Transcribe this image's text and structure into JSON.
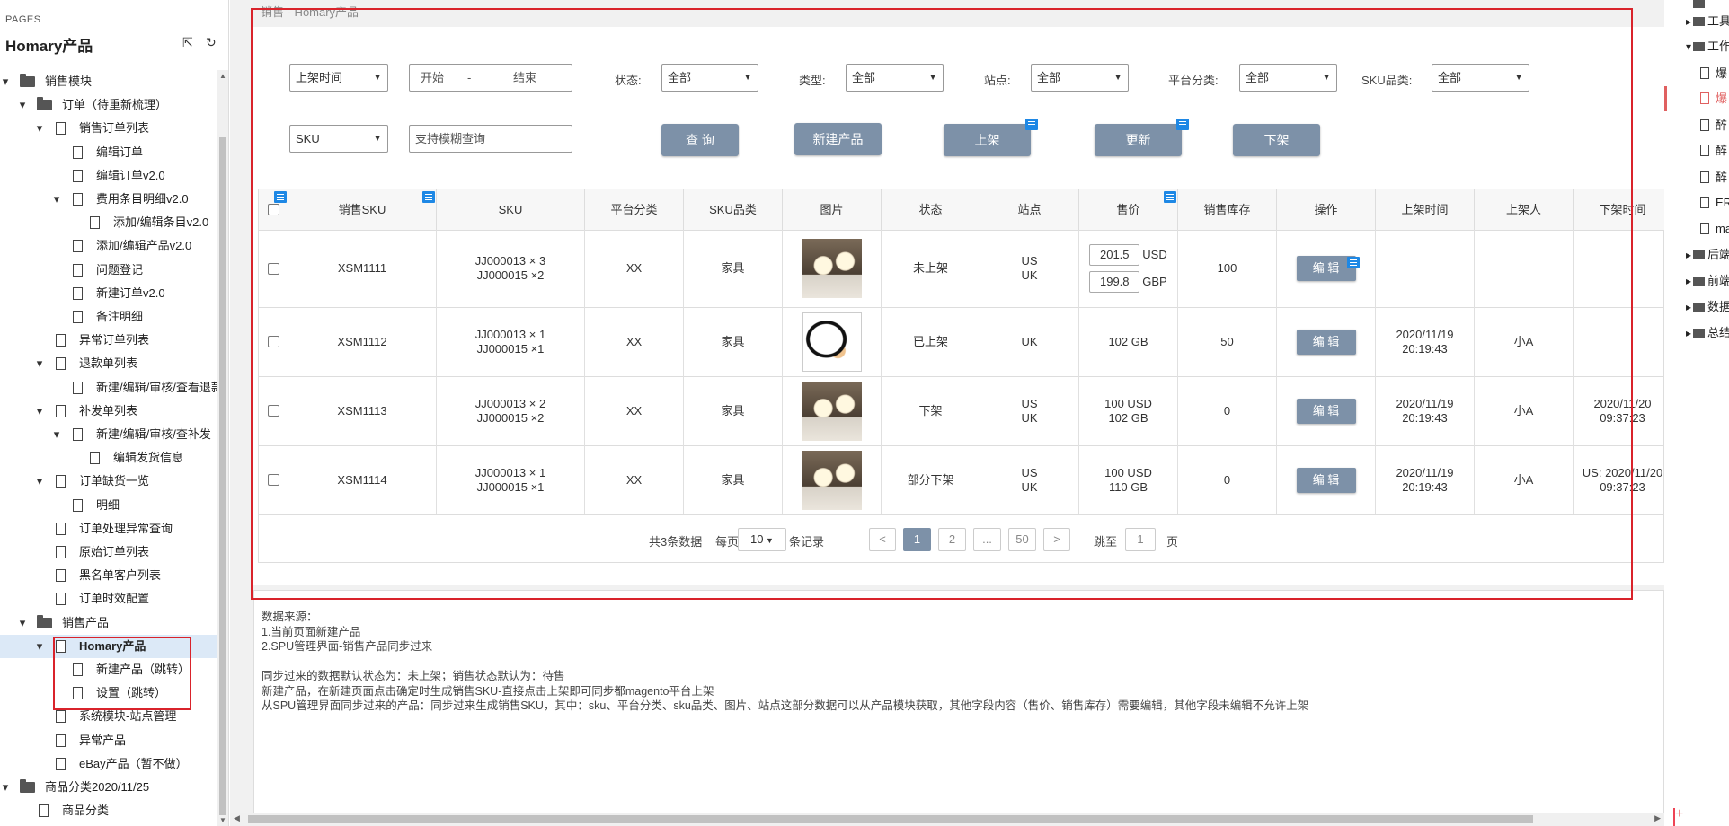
{
  "sidebar": {
    "section_label": "PAGES",
    "page_title": "Homary产品",
    "icons": [
      "export-icon",
      "refresh-icon"
    ],
    "tree": [
      {
        "label": "销售模块",
        "level": 0,
        "type": "folder",
        "expanded": true
      },
      {
        "label": "订单（待重新梳理）",
        "level": 1,
        "type": "folder",
        "expanded": true
      },
      {
        "label": "销售订单列表",
        "level": 2,
        "type": "page",
        "expanded": true
      },
      {
        "label": "编辑订单",
        "level": 3,
        "type": "page"
      },
      {
        "label": "编辑订单v2.0",
        "level": 3,
        "type": "page"
      },
      {
        "label": "费用条目明细v2.0",
        "level": 3,
        "type": "page",
        "expanded": true
      },
      {
        "label": "添加/编辑条目v2.0",
        "level": 4,
        "type": "page"
      },
      {
        "label": "添加/编辑产品v2.0",
        "level": 3,
        "type": "page"
      },
      {
        "label": "问题登记",
        "level": 3,
        "type": "page"
      },
      {
        "label": "新建订单v2.0",
        "level": 3,
        "type": "page"
      },
      {
        "label": "备注明细",
        "level": 3,
        "type": "page"
      },
      {
        "label": "异常订单列表",
        "level": 2,
        "type": "page"
      },
      {
        "label": "退款单列表",
        "level": 2,
        "type": "page",
        "expanded": true
      },
      {
        "label": "新建/编辑/审核/查看退款",
        "level": 3,
        "type": "page"
      },
      {
        "label": "补发单列表",
        "level": 2,
        "type": "page",
        "expanded": true
      },
      {
        "label": "新建/编辑/审核/查补发",
        "level": 3,
        "type": "page",
        "expanded": true
      },
      {
        "label": "编辑发货信息",
        "level": 4,
        "type": "page"
      },
      {
        "label": "订单缺货一览",
        "level": 2,
        "type": "page",
        "expanded": true
      },
      {
        "label": "明细",
        "level": 3,
        "type": "page"
      },
      {
        "label": "订单处理异常查询",
        "level": 2,
        "type": "page"
      },
      {
        "label": "原始订单列表",
        "level": 2,
        "type": "page"
      },
      {
        "label": "黑名单客户列表",
        "level": 2,
        "type": "page"
      },
      {
        "label": "订单时效配置",
        "level": 2,
        "type": "page"
      },
      {
        "label": "销售产品",
        "level": 1,
        "type": "folder",
        "expanded": true
      },
      {
        "label": "Homary产品",
        "level": 2,
        "type": "page",
        "expanded": true,
        "selected": true
      },
      {
        "label": "新建产品（跳转）",
        "level": 3,
        "type": "page"
      },
      {
        "label": "设置（跳转）",
        "level": 3,
        "type": "page"
      },
      {
        "label": "系统模块-站点管理",
        "level": 2,
        "type": "page"
      },
      {
        "label": "异常产品",
        "level": 2,
        "type": "page"
      },
      {
        "label": "eBay产品（暂不做）",
        "level": 2,
        "type": "page"
      },
      {
        "label": "商品分类2020/11/25",
        "level": 0,
        "type": "folder",
        "expanded": true
      },
      {
        "label": "商品分类",
        "level": 1,
        "type": "page"
      }
    ]
  },
  "breadcrumb": "销售 - Homary产品",
  "filters": {
    "date_select": "上架时间",
    "date_start": "开始",
    "date_sep": "-",
    "date_end": "结束",
    "status_label": "状态:",
    "status_value": "全部",
    "type_label": "类型:",
    "type_value": "全部",
    "site_label": "站点:",
    "site_value": "全部",
    "platform_label": "平台分类:",
    "platform_value": "全部",
    "sku_cat_label": "SKU品类:",
    "sku_cat_value": "全部",
    "sku_select": "SKU",
    "sku_placeholder": "支持模糊查询"
  },
  "buttons": {
    "query": "查 询",
    "new_product": "新建产品",
    "list": "上架",
    "update": "更新",
    "delist": "下架"
  },
  "table": {
    "headers": [
      "",
      "销售SKU",
      "SKU",
      "平台分类",
      "SKU品类",
      "图片",
      "状态",
      "站点",
      "售价",
      "销售库存",
      "操作",
      "上架时间",
      "上架人",
      "下架时间"
    ],
    "rows": [
      {
        "sales_sku": "XSM1111",
        "sku": [
          "JJ000013 × 3",
          "JJ000015 ×2"
        ],
        "platform": "XX",
        "category": "家具",
        "image": "lamp-photo",
        "status": "未上架",
        "site": [
          "US",
          "UK"
        ],
        "price": {
          "editable": true,
          "values": [
            {
              "amount": "201.5",
              "currency": "USD"
            },
            {
              "amount": "199.8",
              "currency": "GBP"
            }
          ]
        },
        "stock": "100",
        "action": "编 辑",
        "list_time": [
          "",
          ""
        ],
        "lister": "",
        "delist_time": [
          "",
          ""
        ]
      },
      {
        "sales_sku": "XSM1112",
        "sku": [
          "JJ000013 × 1",
          "JJ000015 ×1"
        ],
        "platform": "XX",
        "category": "家具",
        "image": "cartoon-photo",
        "status": "已上架",
        "site": [
          "UK",
          ""
        ],
        "price": {
          "editable": false,
          "lines": [
            "102 GB",
            ""
          ]
        },
        "stock": "50",
        "action": "编 辑",
        "list_time": [
          "2020/11/19",
          "20:19:43"
        ],
        "lister": "小A",
        "delist_time": [
          "",
          ""
        ]
      },
      {
        "sales_sku": "XSM1113",
        "sku": [
          "JJ000013 × 2",
          "JJ000015 ×2"
        ],
        "platform": "XX",
        "category": "家具",
        "image": "lamp-photo",
        "status": "下架",
        "site": [
          "US",
          "UK"
        ],
        "price": {
          "editable": false,
          "lines": [
            "100 USD",
            "102 GB"
          ]
        },
        "stock": "0",
        "action": "编 辑",
        "list_time": [
          "2020/11/19",
          "20:19:43"
        ],
        "lister": "小A",
        "delist_time": [
          "2020/11/20",
          "09:37:23"
        ]
      },
      {
        "sales_sku": "XSM1114",
        "sku": [
          "JJ000013 × 1",
          "JJ000015 ×1"
        ],
        "platform": "XX",
        "category": "家具",
        "image": "lamp-photo",
        "status": "部分下架",
        "site": [
          "US",
          "UK"
        ],
        "price": {
          "editable": false,
          "lines": [
            "100 USD",
            "110  GB"
          ]
        },
        "stock": "0",
        "action": "编 辑",
        "list_time": [
          "2020/11/19",
          "20:19:43"
        ],
        "lister": "小A",
        "delist_time": [
          "US: 2020/11/20",
          "09:37:23"
        ]
      }
    ]
  },
  "pagination": {
    "total": "共3条数据",
    "per_page_prefix": "每页",
    "per_page_value": "10",
    "per_page_suffix": "条记录",
    "prev": "<",
    "pages": [
      "1",
      "2",
      "...",
      "50"
    ],
    "next": ">",
    "jump_label": "跳至",
    "jump_value": "1",
    "jump_suffix": "页"
  },
  "notes": [
    "数据来源：",
    "1.当前页面新建产品",
    "2.SPU管理界面-销售产品同步过来",
    "",
    "同步过来的数据默认状态为：未上架；销售状态默认为：待售",
    "新建产品，在新建页面点击确定时生成销售SKU-直接点击上架即可同步都magento平台上架",
    "从SPU管理界面同步过来的产品：同步过来生成销售SKU，其中：sku、平台分类、sku品类、图片、站点这部分数据可以从产品模块获取，其他字段内容（售价、销售库存）需要编辑，其他字段未编辑不允许上架"
  ],
  "right_panel": {
    "items": [
      {
        "label": "",
        "type": "folder"
      },
      {
        "label": "工具",
        "type": "folder",
        "caret": "right"
      },
      {
        "label": "工作",
        "type": "folder",
        "caret": "down"
      },
      {
        "label": "爆",
        "type": "page"
      },
      {
        "label": "爆",
        "type": "page",
        "highlight": true
      },
      {
        "label": "醉",
        "type": "page"
      },
      {
        "label": "醉",
        "type": "page"
      },
      {
        "label": "醉",
        "type": "page"
      },
      {
        "label": "ER",
        "type": "page"
      },
      {
        "label": "ma",
        "type": "page"
      },
      {
        "label": "后端",
        "type": "folder",
        "caret": "right"
      },
      {
        "label": "前端",
        "type": "folder",
        "caret": "right"
      },
      {
        "label": "数据",
        "type": "folder",
        "caret": "right"
      },
      {
        "label": "总结",
        "type": "folder",
        "caret": "right"
      }
    ],
    "add_icon": "plus-icon"
  },
  "colors": {
    "button": "#7d91a8",
    "annotation_red": "#d9232b",
    "note_icon_blue": "#1e88e5",
    "selected_row": "#dce9f7"
  }
}
